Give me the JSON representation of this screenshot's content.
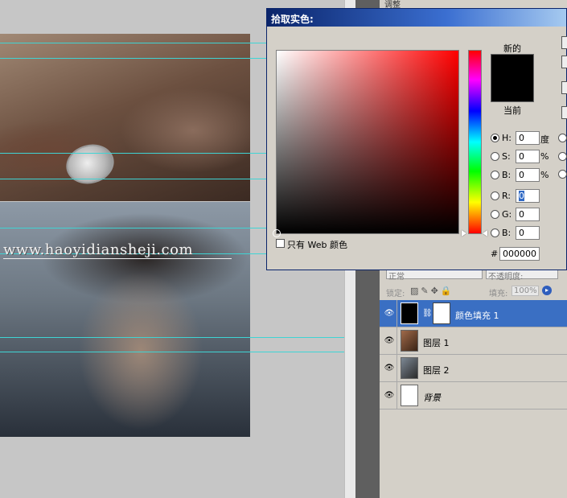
{
  "canvas": {
    "watermark": "www.haoyidiansheji.com"
  },
  "adjust_tab": {
    "label": "调整"
  },
  "color_picker": {
    "title": "拾取实色:",
    "new_label": "新的",
    "current_label": "当前",
    "swatch_color": "#000000",
    "fields": {
      "H": {
        "label": "H:",
        "value": "0",
        "unit": "度"
      },
      "S": {
        "label": "S:",
        "value": "0",
        "unit": "%"
      },
      "B": {
        "label": "B:",
        "value": "0",
        "unit": "%"
      },
      "R": {
        "label": "R:",
        "value": "0"
      },
      "G": {
        "label": "G:",
        "value": "0"
      },
      "B2": {
        "label": "B:",
        "value": "0"
      }
    },
    "hex_label": "#",
    "hex_value": "000000",
    "web_only_label": "只有 Web 颜色"
  },
  "layers": {
    "blend_mode": "正常",
    "opacity_label": "不透明度:",
    "lock_label": "锁定:",
    "fill_label": "填充:",
    "fill_value": "100%",
    "items": [
      {
        "name": "颜色填充 1"
      },
      {
        "name": "图层 1"
      },
      {
        "name": "图层 2"
      },
      {
        "name": "背景"
      }
    ]
  }
}
